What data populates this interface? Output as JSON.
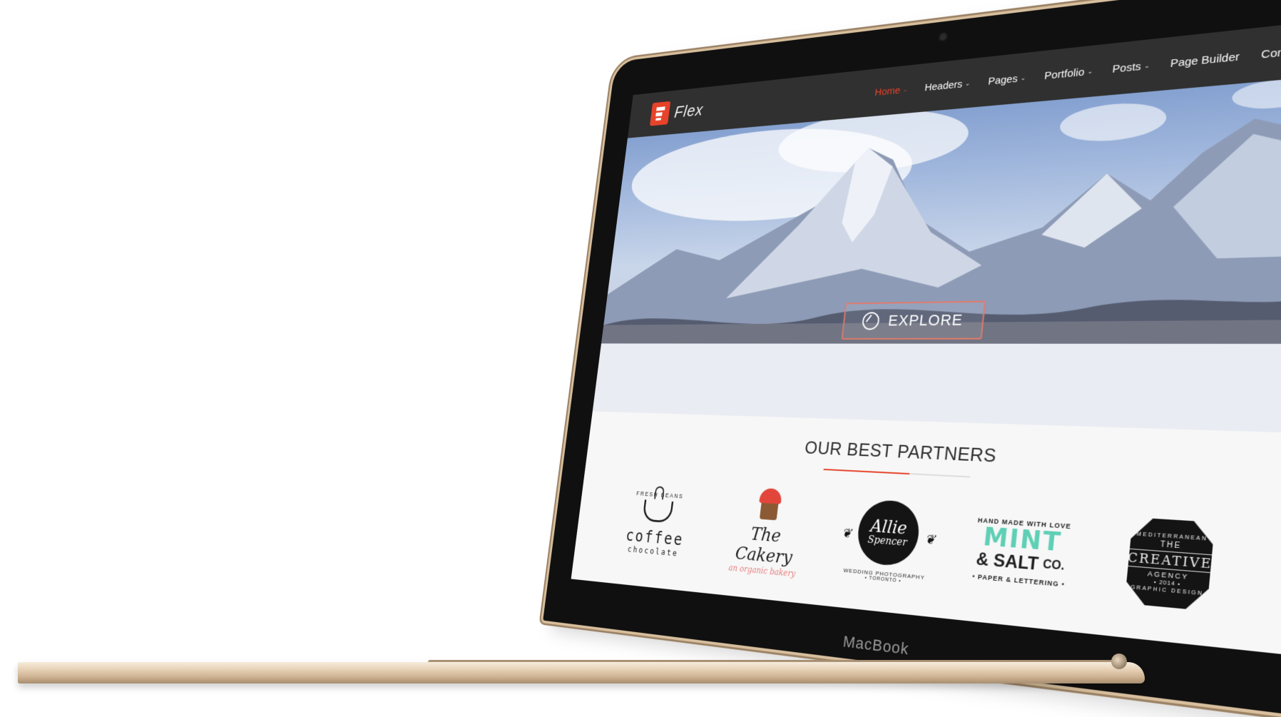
{
  "device": {
    "brand_label": "MacBook"
  },
  "site": {
    "logo_text": "Flex",
    "nav": [
      {
        "label": "Home",
        "dropdown": true,
        "active": true
      },
      {
        "label": "Headers",
        "dropdown": true,
        "active": false
      },
      {
        "label": "Pages",
        "dropdown": true,
        "active": false
      },
      {
        "label": "Portfolio",
        "dropdown": true,
        "active": false
      },
      {
        "label": "Posts",
        "dropdown": true,
        "active": false
      },
      {
        "label": "Page Builder",
        "dropdown": false,
        "active": false
      },
      {
        "label": "Contact",
        "dropdown": false,
        "active": false
      }
    ],
    "hero": {
      "cta_label": "EXPLORE"
    },
    "partners": {
      "title": "OUR BEST PARTNERS",
      "logos": {
        "coffee": {
          "arc": "FRESH BEANS",
          "line1": "coffee",
          "line2": "chocolate"
        },
        "cakery": {
          "line1": "The Cakery",
          "line2": "an organic bakery"
        },
        "allie": {
          "line1": "Allie",
          "line2": "Spencer",
          "line3": "WEDDING PHOTOGRAPHY",
          "line4": "• TORONTO •"
        },
        "mint": {
          "line0": "HAND MADE WITH LOVE",
          "line1": "MINT",
          "line2": "& SALT",
          "co": "CO.",
          "line3": "• PAPER & LETTERING •"
        },
        "creative": {
          "top": "MEDITERRANEAN",
          "the": "THE",
          "main": "CREATIVE",
          "agency": "AGENCY",
          "year": "• 2014 •",
          "bottom": "GRAPHIC DESIGN"
        }
      }
    }
  },
  "colors": {
    "accent": "#e6432a",
    "header_bg": "#303030",
    "bezel": "#101010",
    "gold": "#d8bf9d"
  }
}
